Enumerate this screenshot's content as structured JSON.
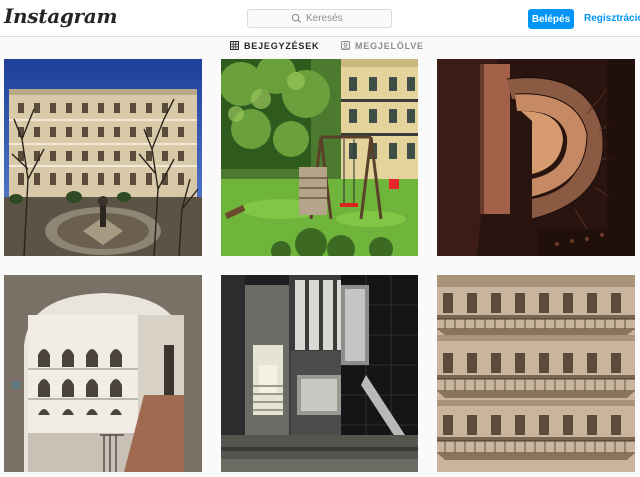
{
  "header": {
    "logo": "Instagram",
    "search_placeholder": "Keresés",
    "login_label": "Belépés",
    "signup_label": "Regisztráció"
  },
  "tabs": [
    {
      "label": "BEJEGYZÉSEK",
      "icon": "grid-icon",
      "active": true
    },
    {
      "label": "MEGJELÖLVE",
      "icon": "tagged-icon",
      "active": false
    }
  ],
  "posts": [
    {
      "name": "courtyard-fountain"
    },
    {
      "name": "garden-swing"
    },
    {
      "name": "spiral-staircase"
    },
    {
      "name": "arched-gallery"
    },
    {
      "name": "stairwell-elevator"
    },
    {
      "name": "balcony-facade"
    }
  ],
  "colors": {
    "accent": "#0095f6",
    "text": "#262626",
    "muted": "#8e8e8e",
    "border": "#dbdbdb"
  }
}
